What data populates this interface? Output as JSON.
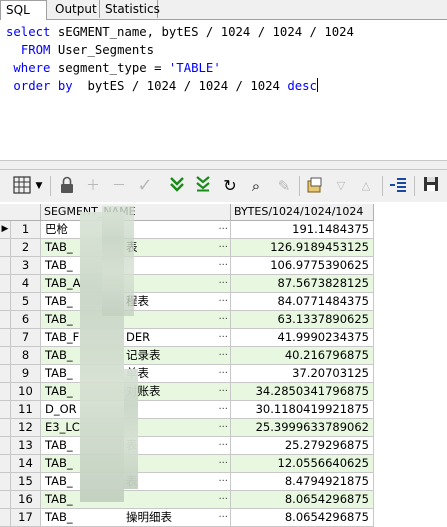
{
  "tabs": [
    "SQL",
    "Output",
    "Statistics"
  ],
  "sql": {
    "line1_kw1": "select",
    "line1_rest": " sEGMENT_name, bytES / 1024 / 1024 / 1024",
    "line2_kw": "FROM",
    "line2_rest": " User_Segments",
    "line3_kw": "where",
    "line3_rest": " segment_type = ",
    "line3_str": "'TABLE'",
    "line4_kw": "order by",
    "line4_rest": "  bytES / 1024 / 1024 / 1024 ",
    "line4_kw2": "desc"
  },
  "grid": {
    "columns": [
      "SEGMENT_NAME",
      "BYTES/1024/1024/1024"
    ],
    "rows": [
      {
        "num": "1",
        "name": "巴枪",
        "value": "191.1484375"
      },
      {
        "num": "2",
        "name": "TAB_",
        "tail": "表",
        "value": "126.9189453125"
      },
      {
        "num": "3",
        "name": "TAB_",
        "value": "106.9775390625"
      },
      {
        "num": "4",
        "name": "TAB_A",
        "value": "87.5673828125"
      },
      {
        "num": "5",
        "name": "TAB_",
        "tail": "程表",
        "value": "84.0771484375"
      },
      {
        "num": "6",
        "name": "TAB_",
        "value": "63.1337890625"
      },
      {
        "num": "7",
        "name": "TAB_F",
        "tail": "DER",
        "value": "41.9990234375"
      },
      {
        "num": "8",
        "name": "TAB_",
        "tail": "记录表",
        "value": "40.216796875"
      },
      {
        "num": "9",
        "name": "TAB_",
        "tail": "单表",
        "value": "37.20703125"
      },
      {
        "num": "10",
        "name": "TAB_",
        "tail": "对账表",
        "value": "34.2850341796875"
      },
      {
        "num": "11",
        "name": "D_OR",
        "value": "30.1180419921875"
      },
      {
        "num": "12",
        "name": "E3_LC",
        "value": "25.3999633789062"
      },
      {
        "num": "13",
        "name": "TAB_",
        "tail": "表",
        "value": "25.279296875"
      },
      {
        "num": "14",
        "name": "TAB_",
        "value": "12.0556640625"
      },
      {
        "num": "15",
        "name": "TAB_",
        "tail": "表",
        "value": "8.4794921875"
      },
      {
        "num": "16",
        "name": "TAB_",
        "value": "8.0654296875"
      },
      {
        "num": "17",
        "name": "TAB_",
        "tail": "操明细表",
        "value": "8.0654296875"
      }
    ]
  }
}
